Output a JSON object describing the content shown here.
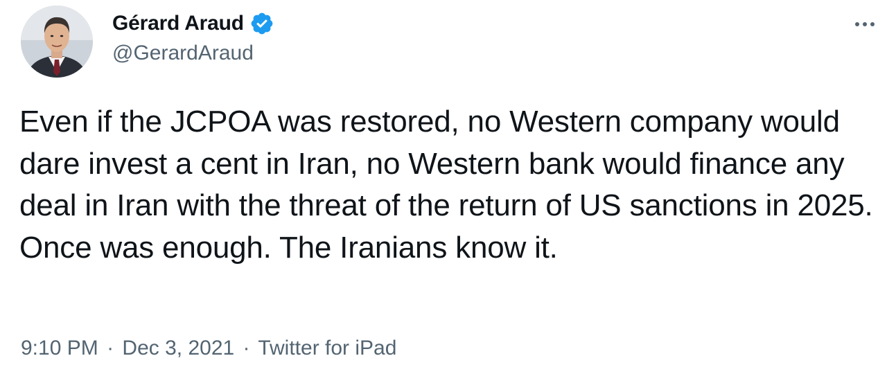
{
  "author": {
    "display_name": "Gérard Araud",
    "handle": "@GerardAraud",
    "verified": true
  },
  "tweet": {
    "text": "Even if the JCPOA was restored, no Western company would dare invest a cent in Iran, no Western bank would finance any deal in Iran with the threat of the return of US sanctions in 2025. Once was enough. The Iranians know it."
  },
  "meta": {
    "time": "9:10 PM",
    "separator": "·",
    "date": "Dec 3, 2021",
    "source": "Twitter for iPad"
  },
  "icons": {
    "verified": "verified-badge-icon",
    "more": "more-options-icon"
  },
  "colors": {
    "verified_blue": "#1d9bf0",
    "secondary_text": "#536471",
    "primary_text": "#0f1419"
  }
}
